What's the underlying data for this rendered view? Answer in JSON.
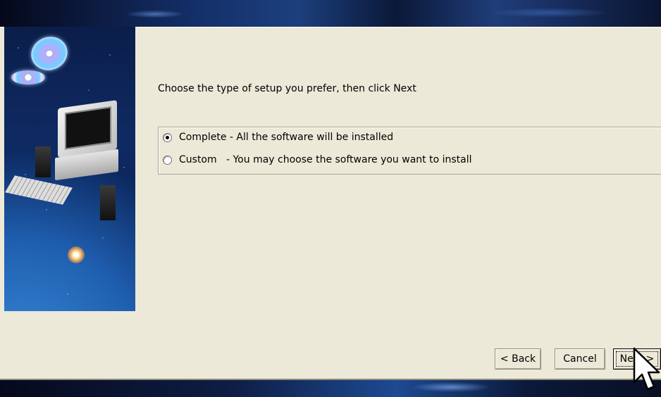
{
  "dialog": {
    "prompt": "Choose the type of setup you prefer, then click Next",
    "options": [
      {
        "label": "Complete - All the software will be installed",
        "selected": true
      },
      {
        "label": "Custom   - You may choose the software you want to install",
        "selected": false
      }
    ]
  },
  "buttons": {
    "back": "< Back",
    "cancel": "Cancel",
    "next": "Next >"
  },
  "colors": {
    "dialog_bg": "#ece9d8",
    "banner_bg": "#0f2a63"
  },
  "icons": {
    "cursor": "mouse-pointer-icon"
  }
}
